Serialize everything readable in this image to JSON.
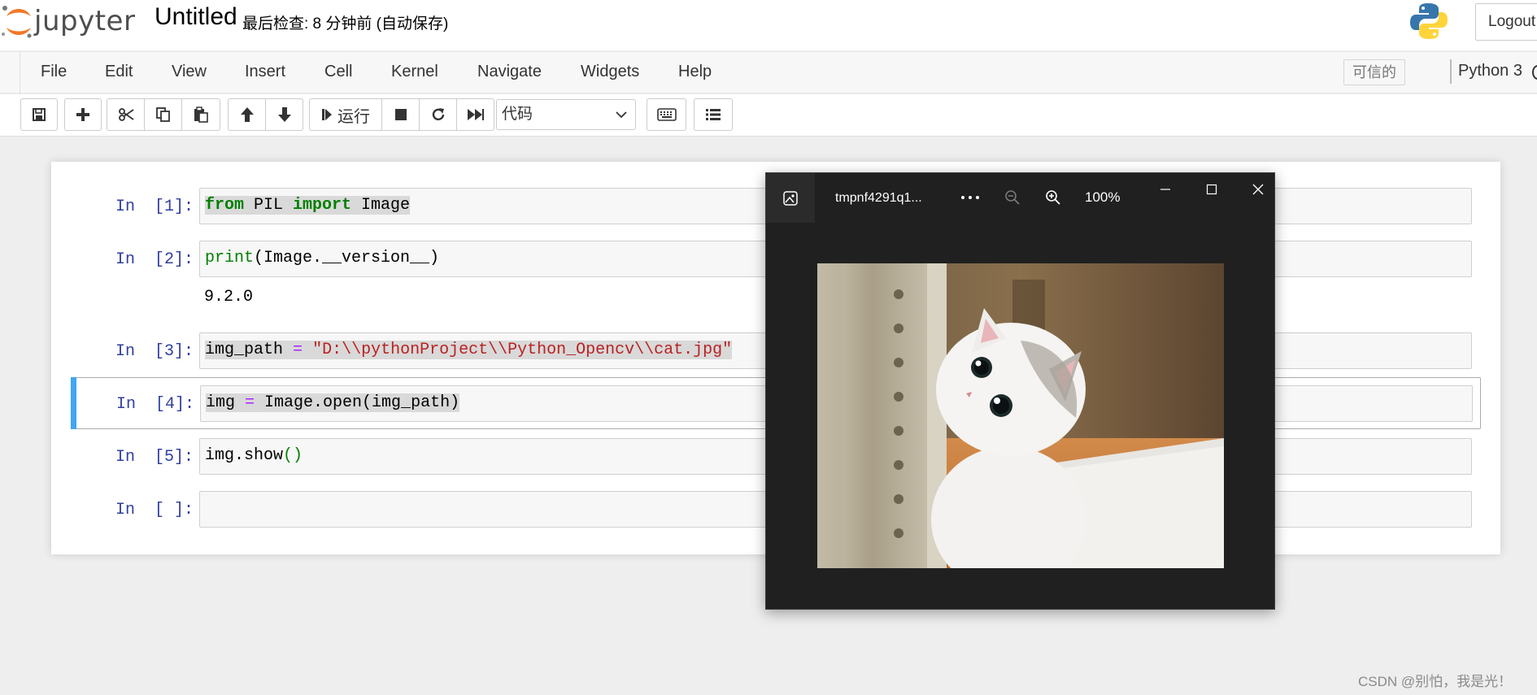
{
  "header": {
    "logo_text": "jupyter",
    "notebook_name": "Untitled",
    "checkpoint": "最后检查: 8 分钟前  (自动保存)",
    "logout_label": "Logout"
  },
  "menubar": {
    "items": [
      "File",
      "Edit",
      "View",
      "Insert",
      "Cell",
      "Kernel",
      "Navigate",
      "Widgets",
      "Help"
    ],
    "trusted_label": "可信的",
    "kernel_name": "Python 3"
  },
  "toolbar": {
    "run_label": "运行",
    "cell_type": "代码"
  },
  "cells": [
    {
      "prompt": "In  [1]:",
      "code_text": "from PIL import Image",
      "output": ""
    },
    {
      "prompt": "In  [2]:",
      "code_text": "print(Image.__version__)",
      "output": "9.2.0"
    },
    {
      "prompt": "In  [3]:",
      "code_text": "img_path = \"D:\\\\pythonProject\\\\Python_Opencv\\\\cat.jpg\"",
      "output": ""
    },
    {
      "prompt": "In  [4]:",
      "code_text": "img = Image.open(img_path)",
      "output": ""
    },
    {
      "prompt": "In  [5]:",
      "code_text": "img.show()",
      "output": ""
    },
    {
      "prompt": "In  [ ]:",
      "code_text": "",
      "output": ""
    }
  ],
  "viewer": {
    "title": "tmpnf4291q1...",
    "zoom": "100%"
  },
  "watermark": "CSDN @别怕，我是光！",
  "colors": {
    "selection_bar": "#42a5f5",
    "prompt": "#303f9f",
    "keyword": "#008000",
    "operator": "#aa22ff",
    "string": "#ba2121",
    "viewer_bg": "#202020"
  }
}
